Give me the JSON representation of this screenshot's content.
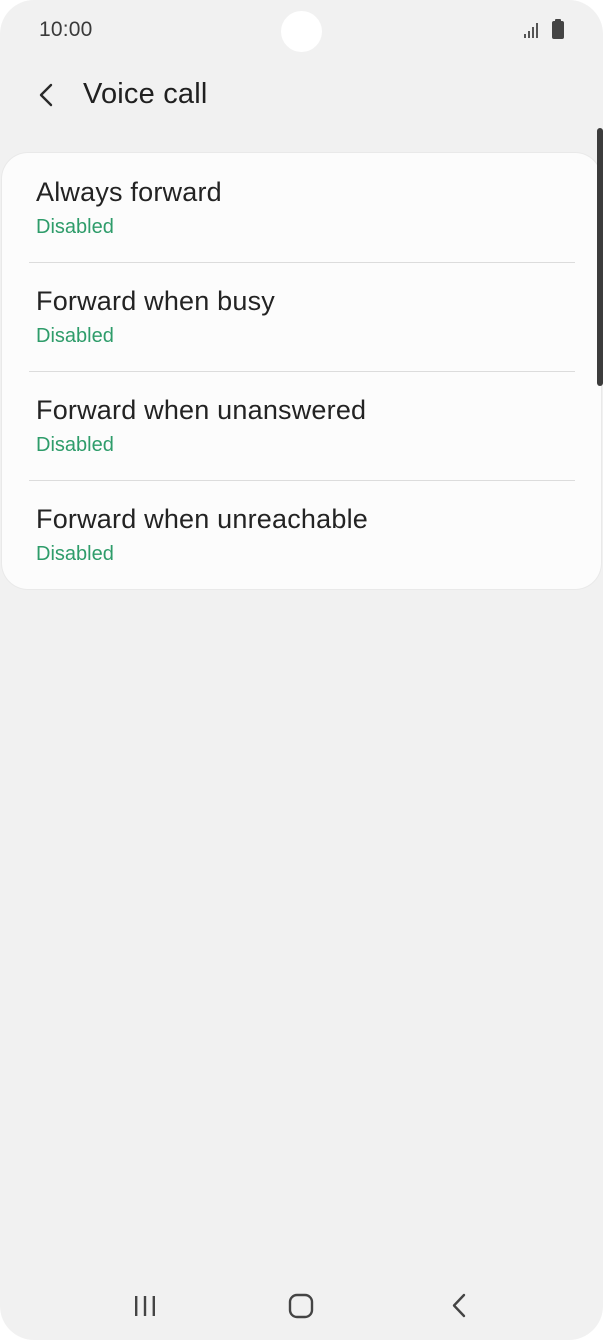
{
  "status_bar": {
    "time": "10:00"
  },
  "header": {
    "title": "Voice call",
    "back_icon": "chevron-left-icon"
  },
  "forwarding_options": [
    {
      "title": "Always forward",
      "status": "Disabled"
    },
    {
      "title": "Forward when busy",
      "status": "Disabled"
    },
    {
      "title": "Forward when unanswered",
      "status": "Disabled"
    },
    {
      "title": "Forward when unreachable",
      "status": "Disabled"
    }
  ],
  "nav_bar": {
    "recents_icon": "recents-icon",
    "home_icon": "home-icon",
    "back_icon": "back-icon"
  },
  "colors": {
    "status_text": "#2e9c6a",
    "background": "#f1f1f1",
    "card": "#fcfcfc"
  }
}
